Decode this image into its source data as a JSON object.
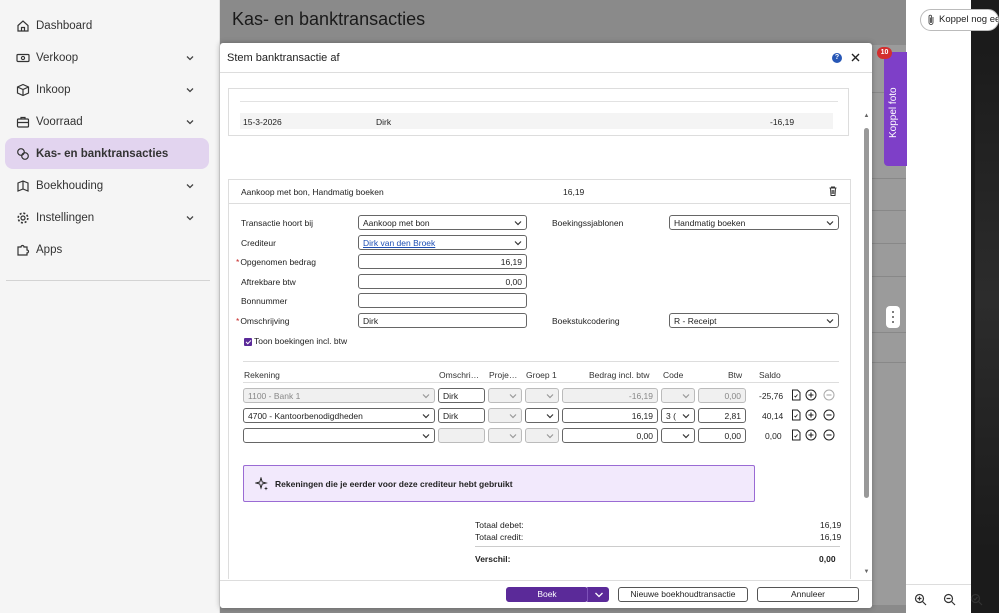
{
  "sidebar": {
    "items": [
      {
        "label": "Dashboard",
        "icon": "home-icon",
        "chevron": false,
        "active": false
      },
      {
        "label": "Verkoop",
        "icon": "money-icon",
        "chevron": true,
        "active": false
      },
      {
        "label": "Inkoop",
        "icon": "box-icon",
        "chevron": true,
        "active": false
      },
      {
        "label": "Voorraad",
        "icon": "briefcase-icon",
        "chevron": true,
        "active": false
      },
      {
        "label": "Kas- en banktransacties",
        "icon": "coins-icon",
        "chevron": false,
        "active": true
      },
      {
        "label": "Boekhouding",
        "icon": "book-icon",
        "chevron": true,
        "active": false
      },
      {
        "label": "Instellingen",
        "icon": "gear-icon",
        "chevron": true,
        "active": false
      },
      {
        "label": "Apps",
        "icon": "puzzle-icon",
        "chevron": false,
        "active": false
      }
    ]
  },
  "page": {
    "title": "Kas- en banktransacties"
  },
  "right_panel": {
    "koppel_label": "Koppel nog een",
    "koppel_foto": "Koppel foto",
    "badge_count": "10"
  },
  "modal": {
    "title": "Stem banktransactie af",
    "transaction": {
      "date": "15-3-2026",
      "name": "Dirk",
      "amount": "-16,19"
    },
    "booking": {
      "header_label": "Aankoop met bon, Handmatig boeken",
      "header_amount": "16,19",
      "fields": {
        "transactie_label": "Transactie hoort bij",
        "transactie_value": "Aankoop met bon",
        "crediteur_label": "Crediteur",
        "crediteur_value": "Dirk van den Broek",
        "bedrag_label": "Opgenomen bedrag",
        "bedrag_value": "16,19",
        "btw_label": "Aftrekbare btw",
        "btw_value": "0,00",
        "bonnummer_label": "Bonnummer",
        "bonnummer_value": "",
        "omschrijving_label": "Omschrijving",
        "omschrijving_value": "Dirk",
        "sjablonen_label": "Boekingssjablonen",
        "sjablonen_value": "Handmatig boeken",
        "codering_label": "Boekstukcodering",
        "codering_value": "R - Receipt",
        "checkbox_label": "Toon boekingen incl. btw",
        "checkbox_checked": true
      },
      "table": {
        "headers": {
          "rekening": "Rekening",
          "omschrijving": "Omschri…",
          "project": "Proje…",
          "groep": "Groep 1",
          "bedrag": "Bedrag incl. btw",
          "code": "Code",
          "btw": "Btw",
          "saldo": "Saldo"
        },
        "rows": [
          {
            "rekening": "1100 - Bank 1",
            "omschrijving": "Dirk",
            "bedrag": "-16,19",
            "code": "",
            "btw": "0,00",
            "saldo": "-25,76",
            "disabled": true
          },
          {
            "rekening": "4700 - Kantoorbenodigdheden",
            "omschrijving": "Dirk",
            "bedrag": "16,19",
            "code": "3 (",
            "btw": "2,81",
            "saldo": "40,14",
            "disabled": false
          },
          {
            "rekening": "",
            "omschrijving": "",
            "bedrag": "0,00",
            "code": "",
            "btw": "0,00",
            "saldo": "0,00",
            "disabled": false
          }
        ]
      },
      "info_text": "Rekeningen die je eerder voor deze crediteur hebt gebruikt",
      "totals": {
        "debet_label": "Totaal debet:",
        "debet_value": "16,19",
        "credit_label": "Totaal credit:",
        "credit_value": "16,19",
        "verschil_label": "Verschil:",
        "verschil_value": "0,00"
      }
    },
    "footer": {
      "boek_label": "Boek",
      "nieuwe_label": "Nieuwe boekhoudtransactie",
      "annuleer_label": "Annuleer"
    }
  },
  "colors": {
    "accent": "#5b2a99",
    "sidebar_active": "#e2d4ef",
    "info_bg": "#f2e9fc",
    "badge": "#d32f2f"
  }
}
